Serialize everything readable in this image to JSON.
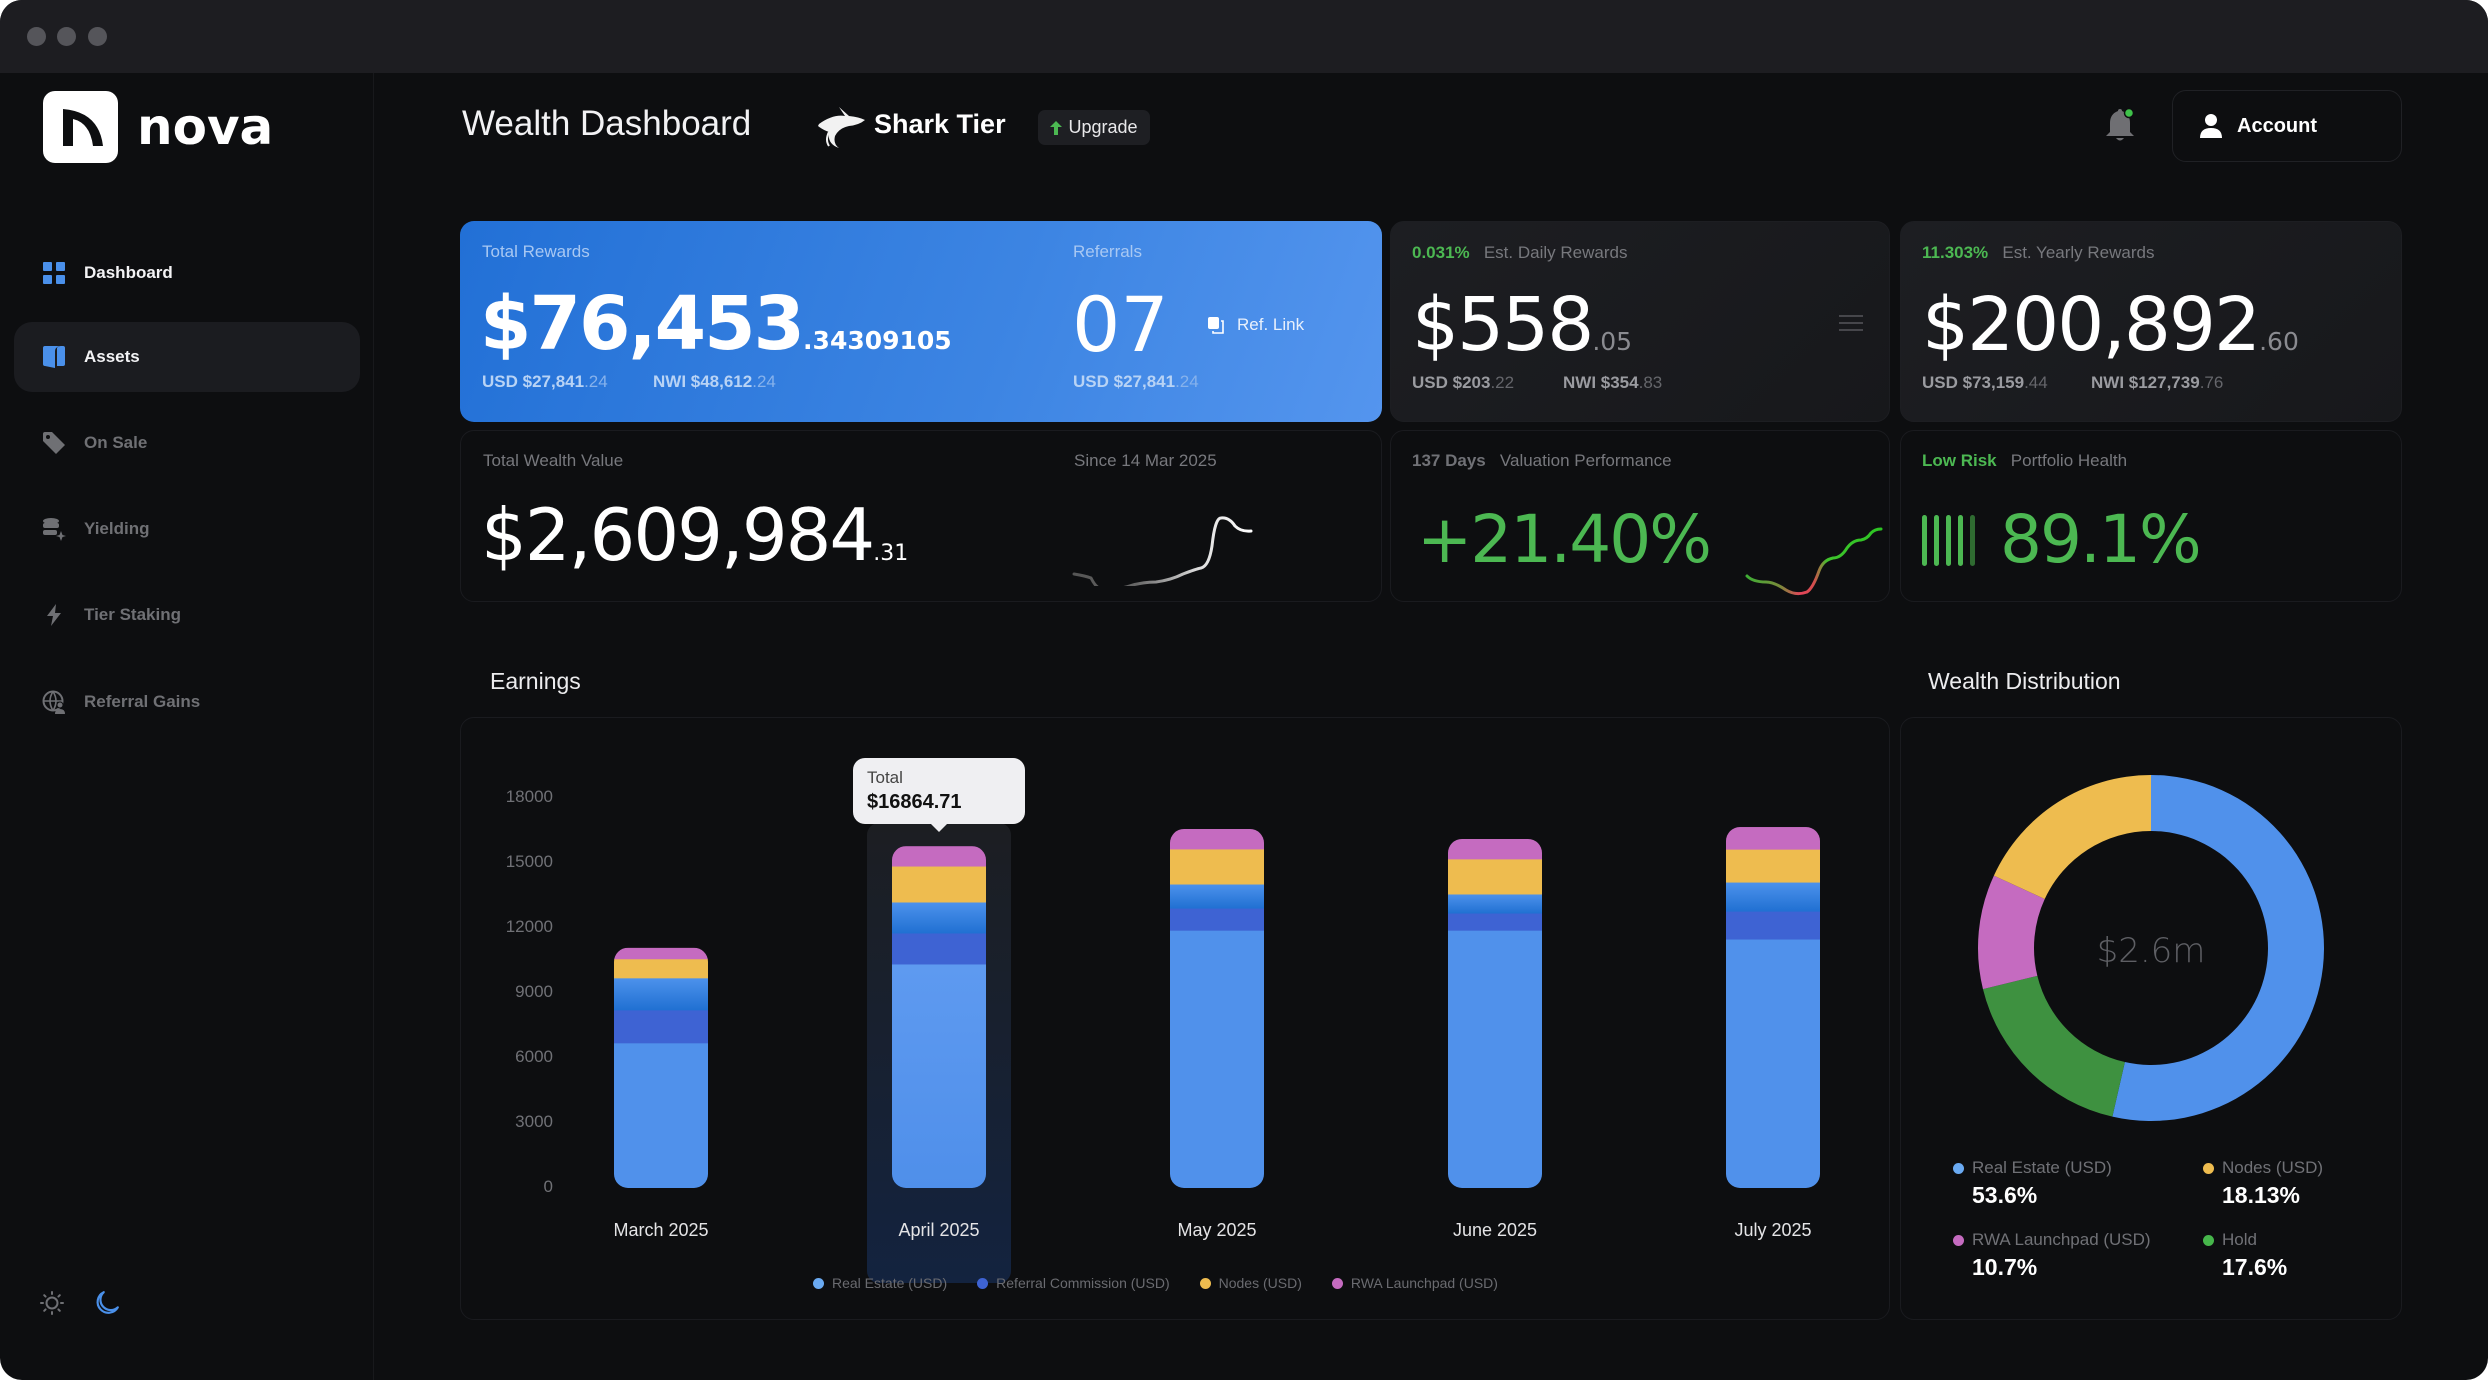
{
  "app": {
    "name": "nova",
    "window_controls": [
      "close",
      "minimize",
      "maximize"
    ]
  },
  "sidebar": {
    "items": [
      {
        "label": "Dashboard",
        "icon": "grid-icon",
        "state": "selected"
      },
      {
        "label": "Assets",
        "icon": "cards-icon",
        "state": "hovered"
      },
      {
        "label": "On Sale",
        "icon": "tag-icon",
        "state": "default"
      },
      {
        "label": "Yielding",
        "icon": "coins-sparkle-icon",
        "state": "default"
      },
      {
        "label": "Tier Staking",
        "icon": "lightning-icon",
        "state": "default"
      },
      {
        "label": "Referral Gains",
        "icon": "globe-user-icon",
        "state": "default"
      }
    ],
    "theme": {
      "light_icon": "sun-icon",
      "dark_icon": "moon-icon",
      "active": "dark"
    }
  },
  "header": {
    "title": "Wealth Dashboard",
    "tier": "Shark Tier",
    "upgrade_label": "Upgrade",
    "account_label": "Account",
    "notification_dot": true
  },
  "cards": {
    "total_rewards": {
      "label": "Total Rewards",
      "amount": "$76,453",
      "decimals": ".34309105",
      "usd_label": "USD $27,841",
      "usd_dec": ".24",
      "nwi_label": "NWI $48,612",
      "nwi_dec": ".24"
    },
    "referrals": {
      "label": "Referrals",
      "count": "07",
      "ref_link_label": "Ref. Link",
      "usd_label": "USD $27,841",
      "usd_dec": ".24"
    },
    "daily": {
      "rate": "0.031%",
      "label": "Est. Daily Rewards",
      "amount": "$558",
      "decimals": ".05",
      "usd_label": "USD $203",
      "usd_dec": ".22",
      "nwi_label": "NWI $354",
      "nwi_dec": ".83"
    },
    "yearly": {
      "rate": "11.303%",
      "label": "Est. Yearly Rewards",
      "amount": "$200,892",
      "decimals": ".60",
      "usd_label": "USD $73,159",
      "usd_dec": ".44",
      "nwi_label": "NWI $127,739",
      "nwi_dec": ".76"
    },
    "total_wealth": {
      "label": "Total Wealth Value",
      "amount": "$2,609,984",
      "decimals": ".31",
      "since_label": "Since 14 Mar 2025"
    },
    "valuation": {
      "days": "137 Days",
      "label": "Valuation Performance",
      "value": "+21.40%"
    },
    "health": {
      "risk": "Low Risk",
      "label": "Portfolio Health",
      "value": "89.1%",
      "bars_filled": 4,
      "bars_total": 5
    }
  },
  "colors": {
    "real_estate": "#5091eb",
    "referral": "#3e63d3",
    "nodes": "#eebc4f",
    "rwa": "#c56bc0",
    "hold": "#3e9140",
    "positive": "#4cb852"
  },
  "chart_data": [
    {
      "type": "bar",
      "stacked": true,
      "title": "Earnings",
      "categories": [
        "March 2025",
        "April 2025",
        "May 2025",
        "June 2025",
        "July 2025"
      ],
      "series": [
        {
          "name": "Real Estate (USD)",
          "color": "#5091eb",
          "values": [
            6700,
            10340,
            11900,
            11900,
            11490
          ]
        },
        {
          "name": "Referral Commission (USD)",
          "color": "#3e63d3",
          "values": [
            1520,
            1430,
            1020,
            790,
            1290
          ]
        },
        {
          "name": "",
          "color": "gradient",
          "values": [
            1480,
            1430,
            1110,
            880,
            1340
          ]
        },
        {
          "name": "Nodes (USD)",
          "color": "#eebc4f",
          "values": [
            880,
            1660,
            1620,
            1620,
            1520
          ]
        },
        {
          "name": "RWA Launchpad (USD)",
          "color": "#c56bc0",
          "values": [
            510,
            920,
            920,
            920,
            1020
          ]
        }
      ],
      "yticks": [
        0,
        3000,
        6000,
        9000,
        12000,
        15000,
        18000
      ],
      "ylim": [
        0,
        18000
      ],
      "grid": false,
      "legend": "bottom",
      "highlighted_category": "April 2025",
      "tooltip": {
        "label": "Total",
        "value": "$16864.71"
      }
    },
    {
      "type": "pie",
      "title": "Wealth Distribution",
      "center_label": "$2.6m",
      "slices": [
        {
          "name": "Real Estate (USD)",
          "value": 53.6,
          "display": "53.6%",
          "color": "#5091eb"
        },
        {
          "name": "Hold",
          "value": 17.6,
          "display": "17.6%",
          "color": "#3e9140"
        },
        {
          "name": "RWA Launchpad (USD)",
          "value": 10.7,
          "display": "10.7%",
          "color": "#c56bc0"
        },
        {
          "name": "Nodes (USD)",
          "value": 18.13,
          "display": "18.13%",
          "color": "#eebc4f"
        }
      ],
      "legend_order": [
        "Real Estate (USD)",
        "Nodes (USD)",
        "RWA Launchpad (USD)",
        "Hold"
      ]
    }
  ]
}
